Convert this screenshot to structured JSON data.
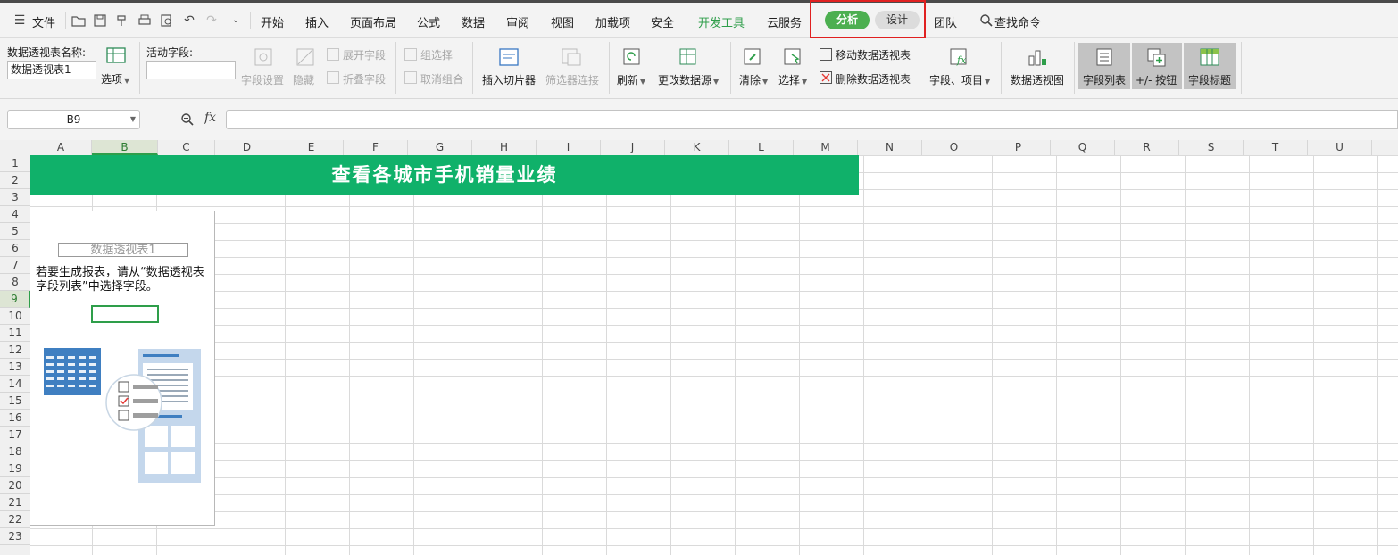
{
  "menu": {
    "file": "文件",
    "tabs": [
      "开始",
      "插入",
      "页面布局",
      "公式",
      "数据",
      "审阅",
      "视图",
      "加载项",
      "安全",
      "开发工具",
      "云服务"
    ],
    "context_tabs": {
      "analyze": "分析",
      "design": "设计"
    },
    "team": "团队",
    "search": "查找命令"
  },
  "ribbon": {
    "pivot_name_label": "数据透视表名称:",
    "pivot_name_value": "数据透视表1",
    "options": "选项",
    "active_field_label": "活动字段:",
    "field_settings": "字段设置",
    "hide": "隐藏",
    "expand_field": "展开字段",
    "collapse_field": "折叠字段",
    "group_selection": "组选择",
    "ungroup": "取消组合",
    "insert_slicer": "插入切片器",
    "filter_connections": "筛选器连接",
    "refresh": "刷新",
    "change_source": "更改数据源",
    "clear": "清除",
    "select": "选择",
    "move_pivot": "移动数据透视表",
    "delete_pivot": "删除数据透视表",
    "fields_items": "字段、项目",
    "pivot_chart": "数据透视图",
    "field_list": "字段列表",
    "buttons": "+/- 按钮",
    "field_headers": "字段标题"
  },
  "formula_bar": {
    "name_box": "B9",
    "fx": "fx",
    "value": ""
  },
  "sheet": {
    "columns": [
      "A",
      "B",
      "C",
      "D",
      "E",
      "F",
      "G",
      "H",
      "I",
      "J",
      "K",
      "L",
      "M",
      "N",
      "O",
      "P",
      "Q",
      "R",
      "S",
      "T",
      "U"
    ],
    "rows": [
      "1",
      "2",
      "3",
      "4",
      "5",
      "6",
      "7",
      "8",
      "9",
      "10",
      "11",
      "12",
      "13",
      "14",
      "15",
      "16",
      "17",
      "18",
      "19",
      "20",
      "21",
      "22",
      "23"
    ],
    "selected_column": "B",
    "selected_row": "9",
    "title": "查看各城市手机销量业绩",
    "pivot_placeholder_name": "数据透视表1",
    "pivot_hint": "若要生成报表，请从“数据透视表字段列表”中选择字段。"
  },
  "colors": {
    "accent_green": "#10b16a",
    "analyze_pill": "#4caf50",
    "highlight_red": "#e02020"
  }
}
